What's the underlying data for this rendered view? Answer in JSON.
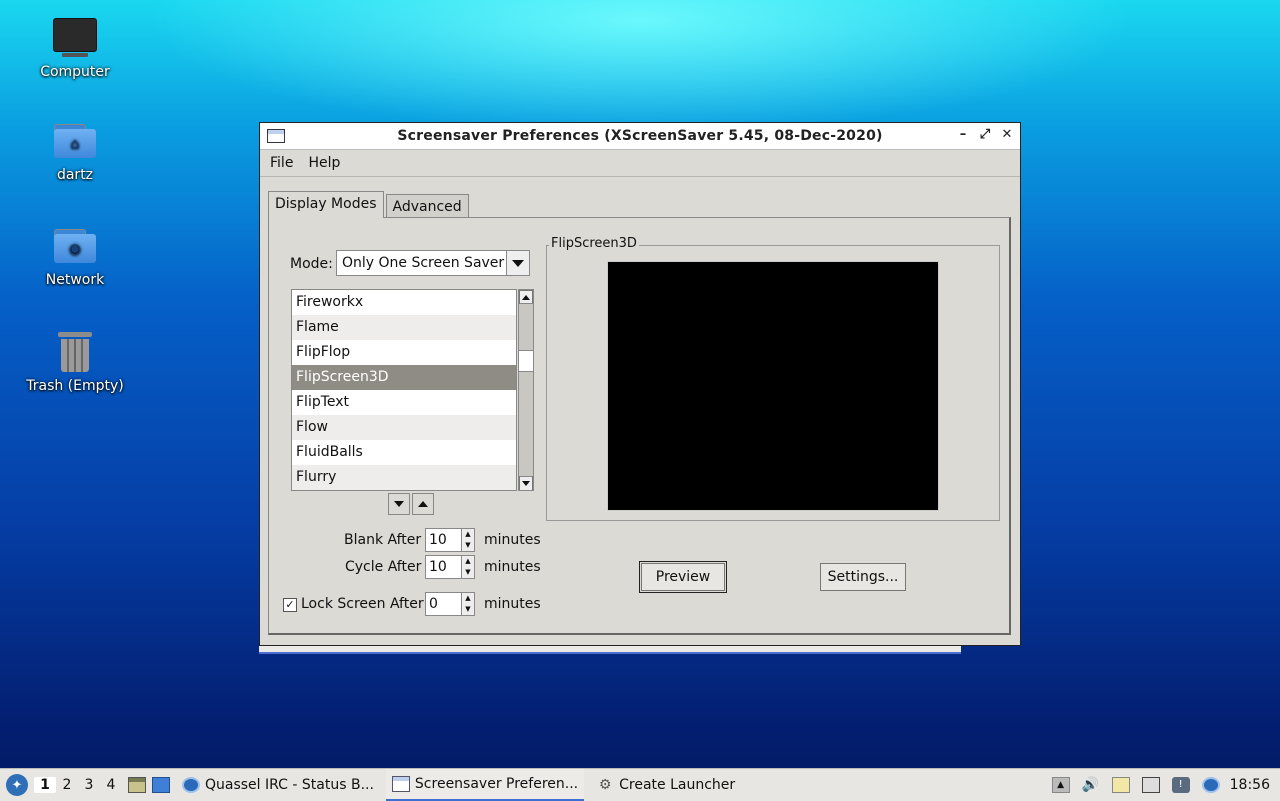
{
  "desktop": {
    "icons": [
      {
        "label": "Computer"
      },
      {
        "label": "dartz"
      },
      {
        "label": "Network"
      },
      {
        "label": "Trash (Empty)"
      }
    ]
  },
  "window": {
    "title": "Screensaver Preferences  (XScreenSaver 5.45, 08-Dec-2020)",
    "controls": {
      "minimize": "–",
      "maximize": "⤢",
      "close": "✕"
    },
    "menu": {
      "file": "File",
      "help": "Help"
    },
    "tabs": [
      {
        "label": "Display Modes",
        "active": true
      },
      {
        "label": "Advanced",
        "active": false
      }
    ],
    "mode": {
      "label": "Mode:",
      "value": "Only One Screen Saver"
    },
    "list": {
      "items": [
        "Fireworkx",
        "Flame",
        "FlipFlop",
        "FlipScreen3D",
        "FlipText",
        "Flow",
        "FluidBalls",
        "Flurry"
      ],
      "selected": "FlipScreen3D"
    },
    "blank_after": {
      "label": "Blank After",
      "value": "10",
      "unit": "minutes"
    },
    "cycle_after": {
      "label": "Cycle After",
      "value": "10",
      "unit": "minutes"
    },
    "lock_screen": {
      "label": "Lock Screen After",
      "checked": true,
      "value": "0",
      "unit": "minutes"
    },
    "preview_frame_title": "FlipScreen3D",
    "buttons": {
      "preview": "Preview",
      "settings": "Settings..."
    }
  },
  "taskbar": {
    "workspaces": [
      "1",
      "2",
      "3",
      "4"
    ],
    "active_workspace": "1",
    "tasks": [
      {
        "label": "Quassel IRC - Status B...",
        "icon": "quassel-icon"
      },
      {
        "label": "Screensaver Preferen...",
        "icon": "window-icon",
        "active": true
      },
      {
        "label": "Create Launcher",
        "icon": "gear-icon"
      }
    ],
    "clock": "18:56"
  }
}
